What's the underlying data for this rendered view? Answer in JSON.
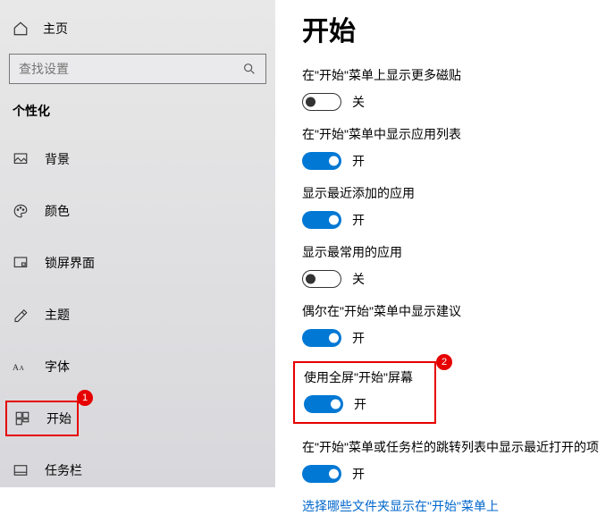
{
  "sidebar": {
    "home_label": "主页",
    "search_placeholder": "查找设置",
    "section_label": "个性化",
    "items": [
      {
        "label": "背景"
      },
      {
        "label": "颜色"
      },
      {
        "label": "锁屏界面"
      },
      {
        "label": "主题"
      },
      {
        "label": "字体"
      },
      {
        "label": "开始"
      },
      {
        "label": "任务栏"
      }
    ]
  },
  "annotations": {
    "badge1": "1",
    "badge2": "2"
  },
  "main": {
    "title": "开始",
    "settings": [
      {
        "label": "在\"开始\"菜单上显示更多磁贴",
        "on": false,
        "state": "关"
      },
      {
        "label": "在\"开始\"菜单中显示应用列表",
        "on": true,
        "state": "开"
      },
      {
        "label": "显示最近添加的应用",
        "on": true,
        "state": "开"
      },
      {
        "label": "显示最常用的应用",
        "on": false,
        "state": "关"
      },
      {
        "label": "偶尔在\"开始\"菜单中显示建议",
        "on": true,
        "state": "开"
      },
      {
        "label": "使用全屏\"开始\"屏幕",
        "on": true,
        "state": "开"
      },
      {
        "label": "在\"开始\"菜单或任务栏的跳转列表中显示最近打开的项",
        "on": true,
        "state": "开"
      }
    ],
    "link": "选择哪些文件夹显示在\"开始\"菜单上"
  }
}
